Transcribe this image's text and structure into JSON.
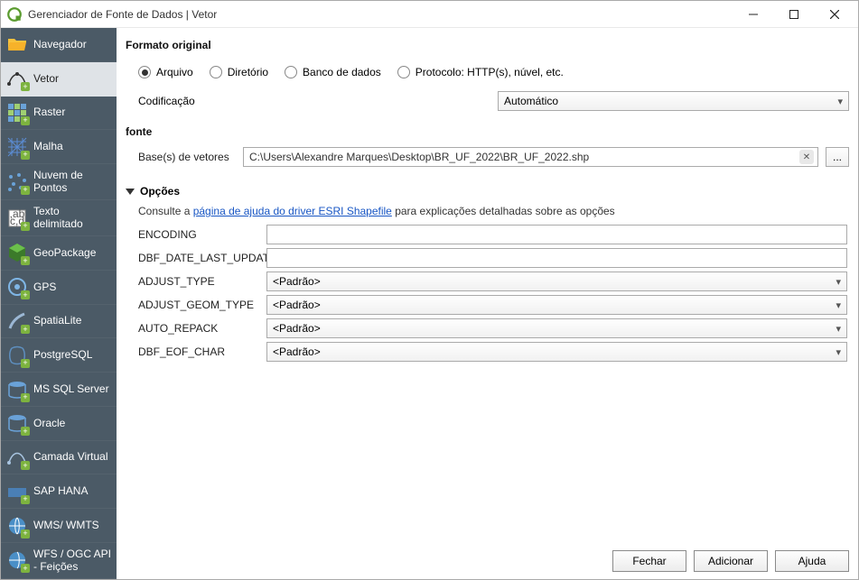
{
  "window": {
    "title": "Gerenciador de Fonte de Dados | Vetor"
  },
  "sidebar": {
    "items": [
      {
        "label": "Navegador"
      },
      {
        "label": "Vetor"
      },
      {
        "label": "Raster"
      },
      {
        "label": "Malha"
      },
      {
        "label": "Nuvem de Pontos"
      },
      {
        "label": "Texto delimitado"
      },
      {
        "label": "GeoPackage"
      },
      {
        "label": "GPS"
      },
      {
        "label": "SpatiaLite"
      },
      {
        "label": "PostgreSQL"
      },
      {
        "label": "MS SQL Server"
      },
      {
        "label": "Oracle"
      },
      {
        "label": "Camada Virtual"
      },
      {
        "label": "SAP HANA"
      },
      {
        "label": "WMS/ WMTS"
      },
      {
        "label": "WFS / OGC API - Feições"
      }
    ]
  },
  "format": {
    "title": "Formato original",
    "opt_file": "Arquivo",
    "opt_dir": "Diretório",
    "opt_db": "Banco de dados",
    "opt_proto": "Protocolo: HTTP(s), núvel, etc.",
    "encoding_label": "Codificação",
    "encoding_value": "Automático"
  },
  "source": {
    "title": "fonte",
    "bases_label": "Base(s) de vetores",
    "bases_value": "C:\\Users\\Alexandre Marques\\Desktop\\BR_UF_2022\\BR_UF_2022.shp",
    "browse": "..."
  },
  "options": {
    "title": "Opções",
    "help_prefix": "Consulte a ",
    "help_link": "página de ajuda do driver ESRI Shapefile",
    "help_suffix": " para explicações detalhadas sobre as opções",
    "rows": [
      {
        "label": "ENCODING",
        "type": "text",
        "value": ""
      },
      {
        "label": "DBF_DATE_LAST_UPDATE",
        "type": "text",
        "value": ""
      },
      {
        "label": "ADJUST_TYPE",
        "type": "select",
        "value": "<Padrão>"
      },
      {
        "label": "ADJUST_GEOM_TYPE",
        "type": "select",
        "value": "<Padrão>"
      },
      {
        "label": "AUTO_REPACK",
        "type": "select",
        "value": "<Padrão>"
      },
      {
        "label": "DBF_EOF_CHAR",
        "type": "select",
        "value": "<Padrão>"
      }
    ]
  },
  "footer": {
    "close": "Fechar",
    "add": "Adicionar",
    "help": "Ajuda"
  }
}
